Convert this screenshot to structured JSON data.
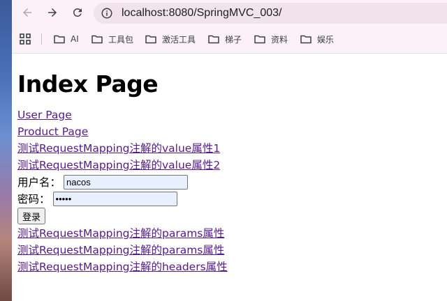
{
  "browser": {
    "url": "localhost:8080/SpringMVC_003/",
    "bookmarks": [
      "AI",
      "工具包",
      "激活工具",
      "梯子",
      "资料",
      "娱乐"
    ]
  },
  "page": {
    "title": "Index Page",
    "links_top": [
      "User Page",
      "Product Page",
      "测试RequestMapping注解的value属性1",
      "测试RequestMapping注解的value属性2"
    ],
    "form": {
      "username_label": "用户名：",
      "username_value": "nacos",
      "password_label": "密码：",
      "password_value": "nacos",
      "submit_label": "登录"
    },
    "links_bottom": [
      "测试RequestMapping注解的params属性",
      "测试RequestMapping注解的params属性",
      "测试RequestMapping注解的headers属性"
    ]
  },
  "colors": {
    "visited_link": "#551a8b",
    "unvisited_link": "#0000ee",
    "toolbar_bg": "#fcf1f6",
    "autofill_bg": "#e8f0fe"
  }
}
